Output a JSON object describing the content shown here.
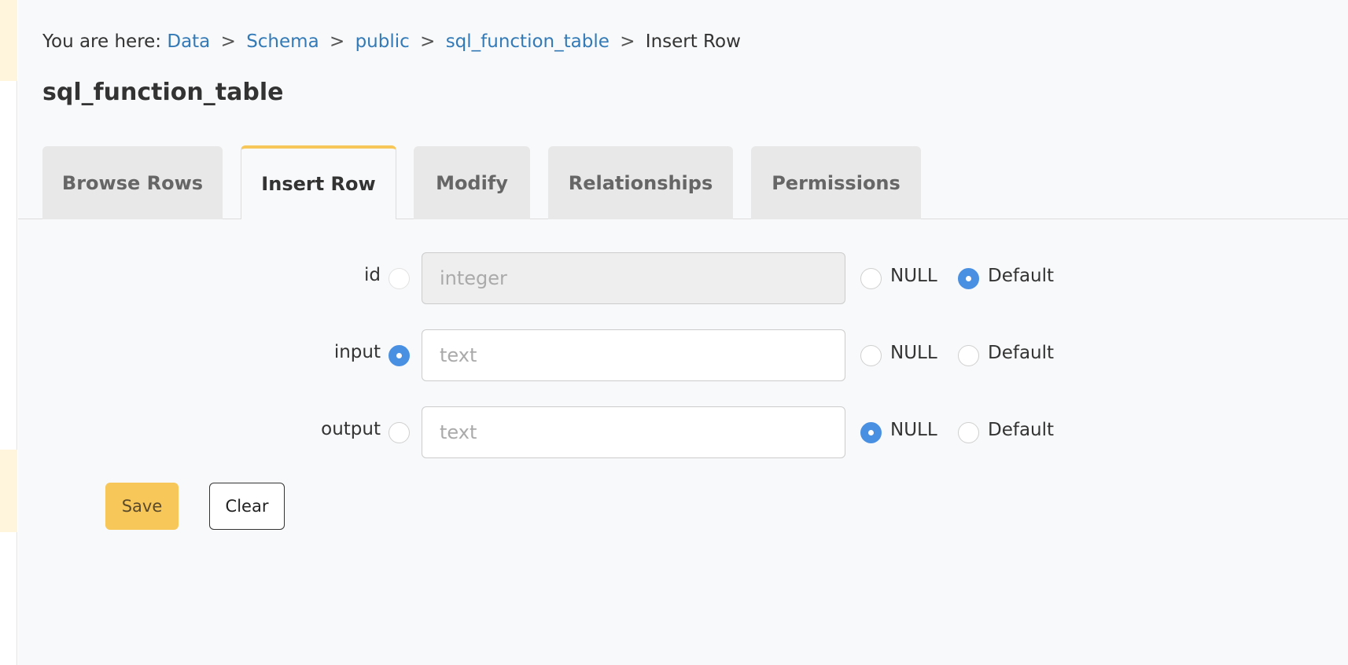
{
  "breadcrumb": {
    "prefix": "You are here:",
    "items": [
      "Data",
      "Schema",
      "public",
      "sql_function_table"
    ],
    "current": "Insert Row",
    "separator": ">"
  },
  "title": "sql_function_table",
  "tabs": [
    {
      "label": "Browse Rows",
      "active": false
    },
    {
      "label": "Insert Row",
      "active": true
    },
    {
      "label": "Modify",
      "active": false
    },
    {
      "label": "Relationships",
      "active": false
    },
    {
      "label": "Permissions",
      "active": false
    }
  ],
  "fields": [
    {
      "name": "id",
      "placeholder": "integer",
      "value_selected": false,
      "null_selected": false,
      "default_selected": true,
      "disabled": true
    },
    {
      "name": "input",
      "placeholder": "text",
      "value_selected": true,
      "null_selected": false,
      "default_selected": false,
      "disabled": false
    },
    {
      "name": "output",
      "placeholder": "text",
      "value_selected": false,
      "null_selected": true,
      "default_selected": false,
      "disabled": false
    }
  ],
  "options": {
    "null_label": "NULL",
    "default_label": "Default"
  },
  "buttons": {
    "save_label": "Save",
    "clear_label": "Clear"
  },
  "colors": {
    "accent": "#f7c75a",
    "link": "#337ab7",
    "radio_checked": "#4a90e2"
  }
}
